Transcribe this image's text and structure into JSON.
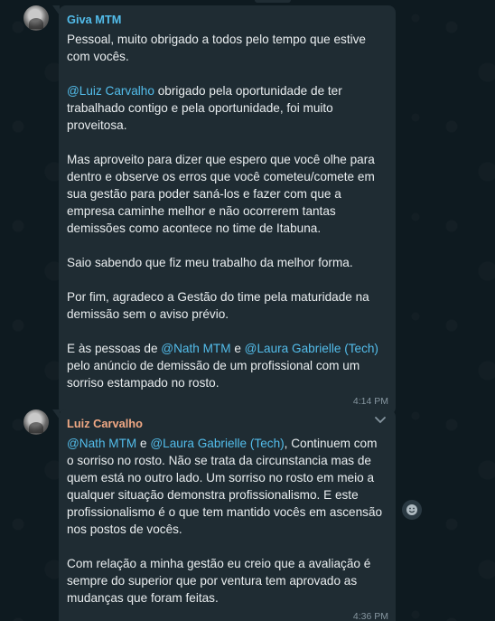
{
  "messages": [
    {
      "sender": "Giva MTM",
      "sender_color": "#53bdeb",
      "paragraphs": [
        [
          {
            "t": "Pessoal, muito obrigado a todos pelo tempo que estive com vocês."
          }
        ],
        [
          {
            "t": "@Luiz Carvalho",
            "m": true
          },
          {
            "t": " obrigado pela oportunidade de ter trabalhado contigo e pela oportunidade, foi muito proveitosa."
          }
        ],
        [
          {
            "t": "Mas aproveito para dizer que espero que você olhe para dentro e observe os erros que você cometeu/comete em sua gestão para poder saná-los e fazer com que a empresa caminhe melhor e não ocorrerem tantas demissões como acontece no time de Itabuna."
          }
        ],
        [
          {
            "t": "Saio sabendo que fiz meu trabalho da melhor forma."
          }
        ],
        [
          {
            "t": "Por fim, agradeco a Gestão do time pela maturidade na demissão sem o aviso prévio."
          }
        ],
        [
          {
            "t": "E às pessoas de "
          },
          {
            "t": "@Nath MTM",
            "m": true
          },
          {
            "t": " e "
          },
          {
            "t": "@Laura Gabrielle (Tech)",
            "m": true
          },
          {
            "t": " pelo anúncio de demissão de um profissional com um sorriso estampado no rosto."
          }
        ]
      ],
      "time": "4:14 PM"
    },
    {
      "sender": "Luiz Carvalho",
      "sender_color": "#f0a884",
      "paragraphs": [
        [
          {
            "t": "@Nath MTM",
            "m": true
          },
          {
            "t": " e "
          },
          {
            "t": "@Laura Gabrielle (Tech)",
            "m": true
          },
          {
            "t": ", Continuem com o sorriso no rosto. Não se trata da circunstancia mas de quem está no outro lado. Um sorriso no rosto em meio a qualquer situação demonstra profissionalismo. E este profissionalismo é o que tem mantido vocês em ascensão nos postos de vocês."
          }
        ],
        [
          {
            "t": "Com relação a minha gestão eu creio que a avaliação é sempre do superior que por ventura tem aprovado as mudanças que foram feitas."
          }
        ]
      ],
      "time": "4:36 PM"
    }
  ],
  "icons": {
    "message_menu": "chevron-down-icon",
    "reaction": "emoji-icon"
  }
}
